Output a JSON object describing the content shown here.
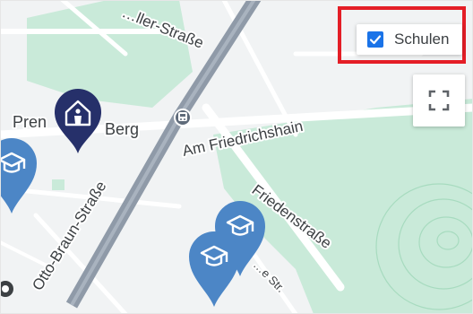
{
  "map": {
    "streets": {
      "top": "…ller-Straße",
      "am_friedrichshain": "Am Friedrichshain",
      "friedenstrasse": "Friedenstraße",
      "otto_braun": "Otto-Braun-Straße",
      "partial_str": "…e Str."
    },
    "places": {
      "prenzlauer_left": "Pren",
      "prenzlauer_right": "Berg"
    },
    "markers": {
      "highlight": {
        "icon": "house-person-icon",
        "color": "#26306a"
      },
      "school": {
        "icon": "graduation-cap-icon",
        "color": "#4c86c6"
      }
    },
    "transit_icon": "train-icon"
  },
  "controls": {
    "filter": {
      "label": "Schulen",
      "checked": true,
      "checkbox_color": "#1a73e8",
      "highlight_color": "#e41e26"
    },
    "fullscreen_icon": "fullscreen-icon"
  },
  "colors": {
    "park": "#c9ead9",
    "park_contour": "#a7dbbf",
    "road_major": "#8f9aa8",
    "road_minor": "#ffffff",
    "background": "#f1f3f4"
  }
}
